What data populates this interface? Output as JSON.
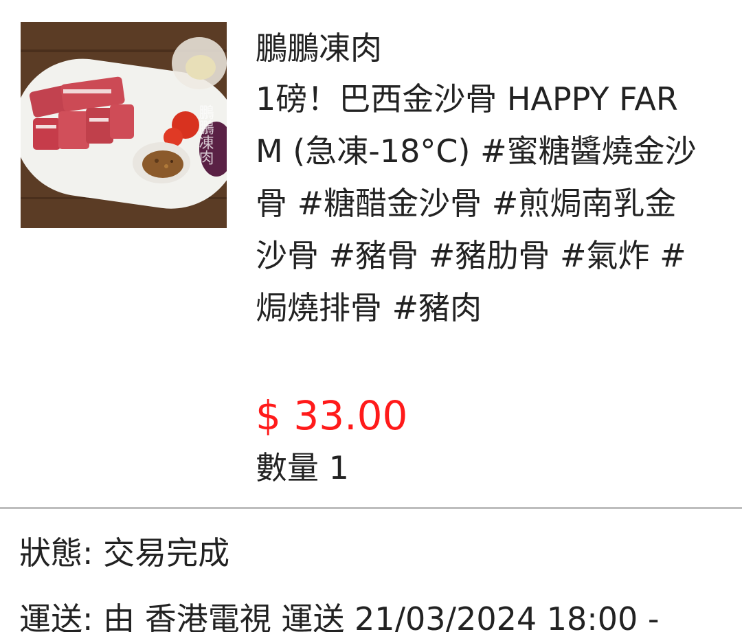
{
  "product": {
    "image_icon": "product-photo",
    "shop_name": "鵬鵬凍肉",
    "title": "1磅！巴西金沙骨 HAPPY FARM (急凍-18°C) #蜜糖醬燒金沙骨 #糖醋金沙骨 #煎焗南乳金沙骨 #豬骨 #豬肋骨 #氣炸 #焗燒排骨 #豬肉",
    "price": "$ 33.00",
    "quantity": "數量 1",
    "image_watermark": "鵬鵬凍肉"
  },
  "order": {
    "status": "狀態: 交易完成",
    "delivery": "運送: 由 香港電視 運送  21/03/2024 18:00 -"
  },
  "colors": {
    "price": "#ff1a1a",
    "divider": "#bdbdbd",
    "text": "#222222"
  }
}
